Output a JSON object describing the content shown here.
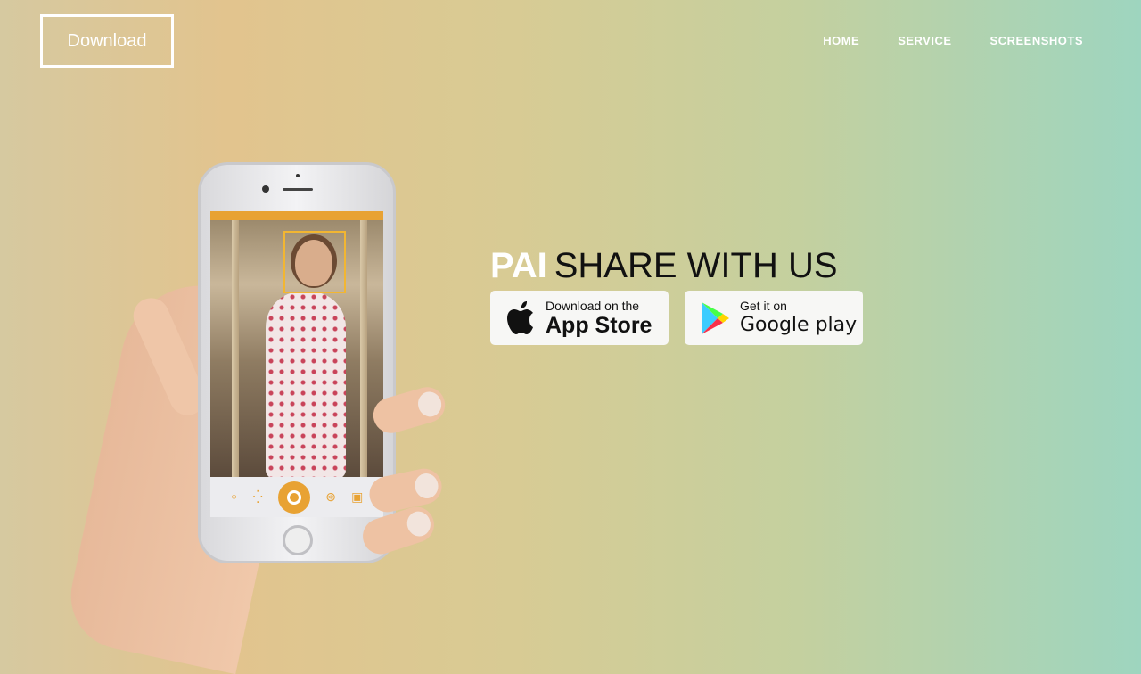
{
  "header": {
    "download_label": "Download",
    "nav": [
      "HOME",
      "SERVICE",
      "SCREENSHOTS"
    ]
  },
  "hero": {
    "brand": "PAI",
    "tagline": "SHARE WITH US"
  },
  "stores": {
    "apple": {
      "small": "Download on the",
      "big": "App Store",
      "icon": "apple-icon"
    },
    "google": {
      "small": "Get it on",
      "big": "Google play",
      "icon": "google-play-icon"
    }
  },
  "colors": {
    "accent": "#e8a233",
    "text_dark": "#111111",
    "white": "#ffffff"
  }
}
